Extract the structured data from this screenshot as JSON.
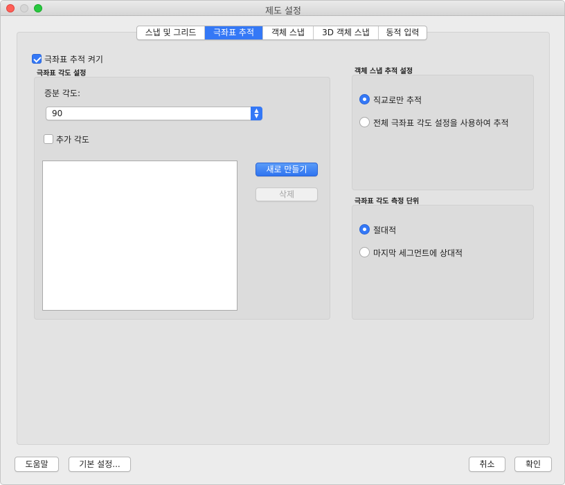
{
  "window": {
    "title": "제도 설정"
  },
  "tabs": [
    {
      "label": "스냅 및 그리드",
      "active": false
    },
    {
      "label": "극좌표 추적",
      "active": true
    },
    {
      "label": "객체 스냅",
      "active": false
    },
    {
      "label": "3D 객체 스냅",
      "active": false
    },
    {
      "label": "동적 입력",
      "active": false
    }
  ],
  "polar_tracking": {
    "enable_label": "극좌표 추적 켜기",
    "enabled": true,
    "angle_settings": {
      "section_title": "극좌표 각도 설정",
      "increment_label": "증분 각도:",
      "increment_value": "90",
      "additional_label": "추가 각도",
      "additional_checked": false,
      "new_button": "새로 만들기",
      "delete_button": "삭제"
    }
  },
  "object_snap_tracking": {
    "section_title": "객체 스냅 추적 설정",
    "options": [
      {
        "label": "직교로만 추적",
        "selected": true
      },
      {
        "label": "전체 극좌표 각도 설정을 사용하여 추적",
        "selected": false
      }
    ]
  },
  "angle_measurement": {
    "section_title": "극좌표 각도 측정 단위",
    "options": [
      {
        "label": "절대적",
        "selected": true
      },
      {
        "label": "마지막 세그먼트에 상대적",
        "selected": false
      }
    ]
  },
  "footer": {
    "help": "도움말",
    "defaults": "기본 설정...",
    "cancel": "취소",
    "ok": "확인"
  },
  "colors": {
    "accent": "#3478f6"
  }
}
